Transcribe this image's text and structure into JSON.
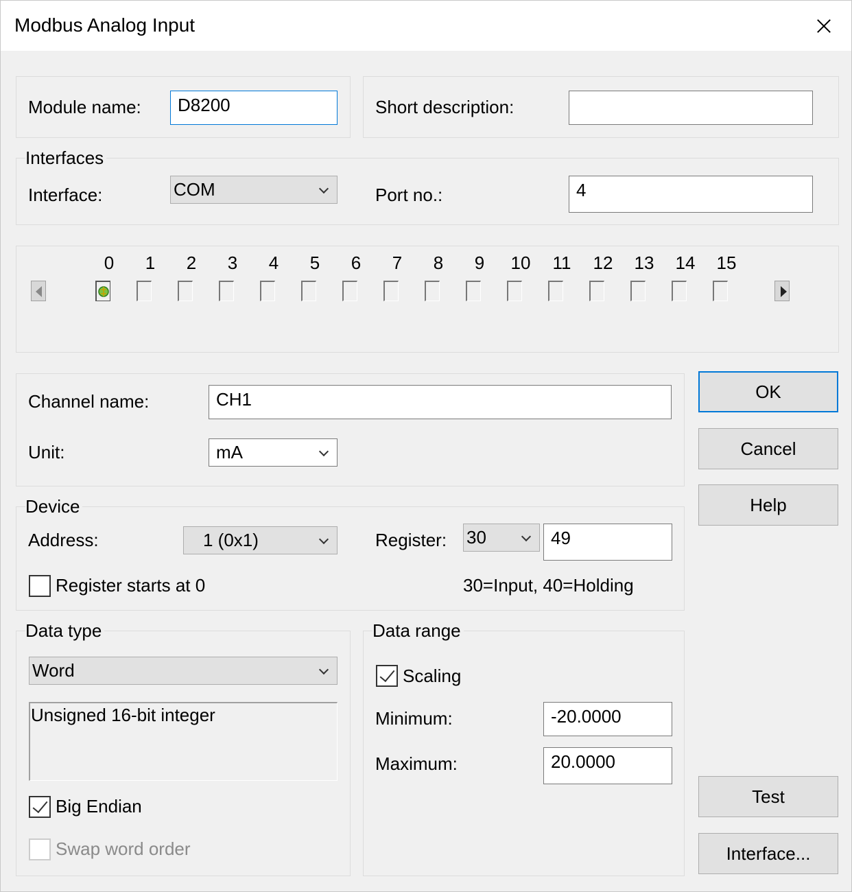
{
  "window": {
    "title": "Modbus Analog Input"
  },
  "module": {
    "name_label": "Module name:",
    "name_value": "D8200",
    "desc_label": "Short description:",
    "desc_value": ""
  },
  "interfaces": {
    "group_label": "Interfaces",
    "interface_label": "Interface:",
    "interface_value": "COM",
    "port_label": "Port no.:",
    "port_value": "4"
  },
  "channels": {
    "numbers": [
      "0",
      "1",
      "2",
      "3",
      "4",
      "5",
      "6",
      "7",
      "8",
      "9",
      "10",
      "11",
      "12",
      "13",
      "14",
      "15"
    ],
    "selected": "0"
  },
  "channel": {
    "name_label": "Channel name:",
    "name_value": "CH1",
    "unit_label": "Unit:",
    "unit_value": "mA"
  },
  "device": {
    "group_label": "Device",
    "address_label": "Address:",
    "address_value": "1 (0x1)",
    "register_label": "Register:",
    "register_type": "30",
    "register_value": "49",
    "register_zero_label": "Register starts at 0",
    "register_hint": "30=Input, 40=Holding"
  },
  "data_type": {
    "group_label": "Data type",
    "type_value": "Word",
    "description": "Unsigned 16-bit integer",
    "big_endian_label": "Big Endian",
    "swap_label": "Swap word order"
  },
  "data_range": {
    "group_label": "Data range",
    "scaling_label": "Scaling",
    "min_label": "Minimum:",
    "min_value": "-20.0000",
    "max_label": "Maximum:",
    "max_value": "20.0000"
  },
  "buttons": {
    "ok": "OK",
    "cancel": "Cancel",
    "help": "Help",
    "test": "Test",
    "interface": "Interface..."
  }
}
